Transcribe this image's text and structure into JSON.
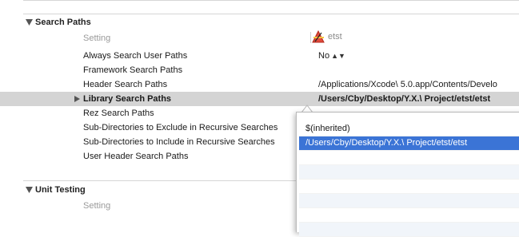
{
  "sections": {
    "search_paths": {
      "title": "Search Paths",
      "setting_header": "Setting",
      "target_name": "etst",
      "rows": [
        {
          "name": "Always Search User Paths",
          "value": "No",
          "stepper": "▲▼"
        },
        {
          "name": "Framework Search Paths",
          "value": ""
        },
        {
          "name": "Header Search Paths",
          "value": "/Applications/Xcode\\ 5.0.app/Contents/Develo"
        },
        {
          "name": "Library Search Paths",
          "value": "/Users/Cby/Desktop/Y.X.\\ Project/etst/etst"
        },
        {
          "name": "Rez Search Paths",
          "value": ""
        },
        {
          "name": "Sub-Directories to Exclude in Recursive Searches",
          "value": ""
        },
        {
          "name": "Sub-Directories to Include in Recursive Searches",
          "value": ""
        },
        {
          "name": "User Header Search Paths",
          "value": ""
        }
      ]
    },
    "unit_testing": {
      "title": "Unit Testing",
      "setting_header": "Setting"
    }
  },
  "popover": {
    "items": [
      "$(inherited)",
      "/Users/Cby/Desktop/Y.X.\\ Project/etst/etst"
    ]
  },
  "colors": {
    "selection_row": "#d4d4d4",
    "popover_selection": "#3b74d6"
  }
}
